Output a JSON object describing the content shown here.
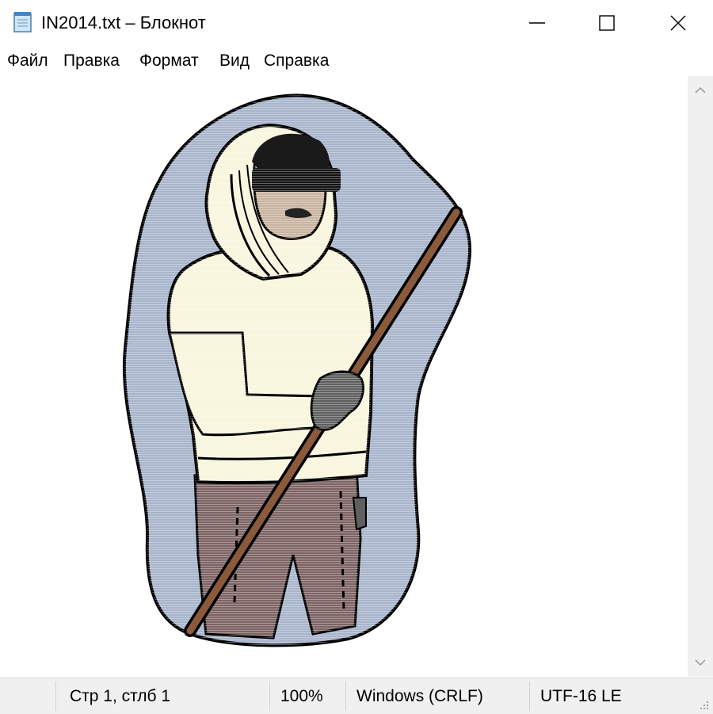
{
  "window": {
    "title": "IN2014.txt – Блокнот",
    "icon": "notepad-icon"
  },
  "menu": {
    "items": [
      {
        "label": "Файл"
      },
      {
        "label": "Правка"
      },
      {
        "label": "Формат"
      },
      {
        "label": "Вид"
      },
      {
        "label": "Справка"
      }
    ]
  },
  "editor": {
    "content_icon": "ascii-art-hooded-man-with-staff"
  },
  "statusbar": {
    "position": "Стр 1, стлб 1",
    "zoom": "100%",
    "line_ending": "Windows (CRLF)",
    "encoding": "UTF-16 LE"
  },
  "colors": {
    "sky": "#a7b4cb",
    "coat": "#f8f5dc",
    "trousers": "#7d6363",
    "staff": "#8b5a3c",
    "glove": "#5f5f5f",
    "skin": "#c8b39f",
    "outline": "#000000"
  }
}
